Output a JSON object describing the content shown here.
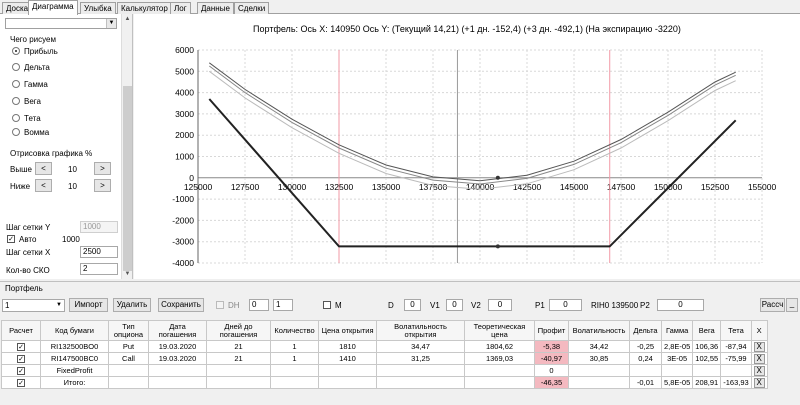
{
  "tabs": [
    "Доска",
    "Диаграмма",
    "Улыбка",
    "Калькулятор",
    "Лог",
    "Данные",
    "Сделки"
  ],
  "active_tab": 1,
  "left": {
    "draw_label": "Чего рисуем",
    "radios": [
      {
        "label": "Прибыль",
        "checked": true
      },
      {
        "label": "Дельта",
        "checked": false
      },
      {
        "label": "Гамма",
        "checked": false
      },
      {
        "label": "Вега",
        "checked": false
      },
      {
        "label": "Тета",
        "checked": false
      },
      {
        "label": "Вомма",
        "checked": false
      }
    ],
    "render_label": "Отрисовка графика %",
    "above_label": "Выше",
    "above_value": "10",
    "below_label": "Ниже",
    "below_value": "10",
    "less": "<",
    "more": ">",
    "grid_y_label": "Шаг сетки Y",
    "grid_y_value": "1000",
    "auto_label": "Авто",
    "auto_value": "1000",
    "grid_x_label": "Шаг сетки X",
    "grid_x_value": "2500",
    "sko_label": "Кол-во СКО",
    "sko_value": "2"
  },
  "chart_header": "Портфель: Ось X: 140950 Ось Y:  (Текущий 14,21)  (+1 дн. -152,4)  (+3 дн. -492,1)  (На экспирацию -3220)",
  "chart_data": {
    "type": "line",
    "xlim": [
      125000,
      155000
    ],
    "ylim": [
      -4000,
      6000
    ],
    "x_ticks": [
      "125000",
      "127500",
      "130000",
      "132500",
      "135000",
      "137500",
      "140000",
      "142500",
      "145000",
      "147500",
      "150000",
      "152500",
      "155000"
    ],
    "y_ticks": [
      "6000",
      "5000",
      "4000",
      "3000",
      "2000",
      "1000",
      "0",
      "-1000",
      "-2000",
      "-3000",
      "-4000"
    ],
    "grid": true,
    "current_x": 138800,
    "marker_x": 140950,
    "strike_lines": [
      132500,
      146900
    ],
    "series": [
      {
        "x": [
          125600,
          132500,
          146900,
          153600
        ],
        "y": [
          3700,
          -3220,
          -3220,
          2700
        ],
        "color": "#222222"
      },
      {
        "x": [
          125600,
          127500,
          130000,
          132500,
          135000,
          137500,
          140000,
          142500,
          145000,
          147500,
          150000,
          152500,
          153600
        ],
        "y": [
          5400,
          4150,
          2750,
          1550,
          600,
          40,
          -140,
          120,
          780,
          1800,
          3080,
          4500,
          4960
        ],
        "color": "#555555"
      },
      {
        "x": [
          125600,
          127500,
          130000,
          132500,
          135000,
          137500,
          140000,
          142500,
          145000,
          147500,
          150000,
          152500,
          153600
        ],
        "y": [
          5250,
          4000,
          2600,
          1400,
          450,
          -110,
          -290,
          -30,
          630,
          1650,
          2930,
          4350,
          4810
        ],
        "color": "#888888"
      },
      {
        "x": [
          125600,
          127500,
          130000,
          132500,
          135000,
          137500,
          140000,
          142500,
          145000,
          147500,
          150000,
          152500,
          153600
        ],
        "y": [
          5000,
          3750,
          2350,
          1150,
          200,
          -360,
          -540,
          -280,
          380,
          1400,
          2680,
          4100,
          4560
        ],
        "color": "#bbbbbb"
      }
    ]
  },
  "portfolio": {
    "group_label": "Портфель",
    "select_value": "1",
    "import_label": "Импорт",
    "delete_label": "Удалить",
    "save_label": "Сохранить",
    "dh_label": "DH",
    "dh_a": "0",
    "dh_b": "1",
    "m_label": "M",
    "d_label": "D",
    "d_value": "0",
    "v1_label": "V1",
    "v1_value": "0",
    "v2_label": "V2",
    "v2_value": "0",
    "p1_label": "P1",
    "p1_value": "0",
    "rih_label": "RIH0 139500",
    "p2_label": "P2",
    "p2_value": "0",
    "calc_label": "Рассч",
    "extra_label": "_"
  },
  "table": {
    "headers": [
      "Расчет",
      "Код бумаги",
      "Тип опциона",
      "Дата погашения",
      "Дней до погашения",
      "Количество",
      "Цена открытия",
      "Волатильность открытия",
      "Теоретическая цена",
      "Профит",
      "Волатильность",
      "Дельта",
      "Гамма",
      "Вега",
      "Тета",
      "X"
    ],
    "rows": [
      [
        "✓",
        "RI132500BO0",
        "Put",
        "19.03.2020",
        "21",
        "1",
        "1810",
        "34,47",
        "1804,62",
        "-5,38",
        "34,42",
        "-0,25",
        "2,8E-05",
        "106,36",
        "-87,94",
        "X"
      ],
      [
        "✓",
        "RI147500BC0",
        "Call",
        "19.03.2020",
        "21",
        "1",
        "1410",
        "31,25",
        "1369,03",
        "-40,97",
        "30,85",
        "0,24",
        "3E-05",
        "102,55",
        "-75,99",
        "X"
      ],
      [
        "✓",
        "FixedProfit",
        "",
        "",
        "",
        "",
        "",
        "",
        "",
        "0",
        "",
        "",
        "",
        "",
        "",
        "X"
      ],
      [
        "✓",
        "Итого:",
        "",
        "",
        "",
        "",
        "",
        "",
        "",
        "-46,35",
        "",
        "-0,01",
        "5,8E-05",
        "208,91",
        "-163,93",
        "X"
      ]
    ]
  }
}
